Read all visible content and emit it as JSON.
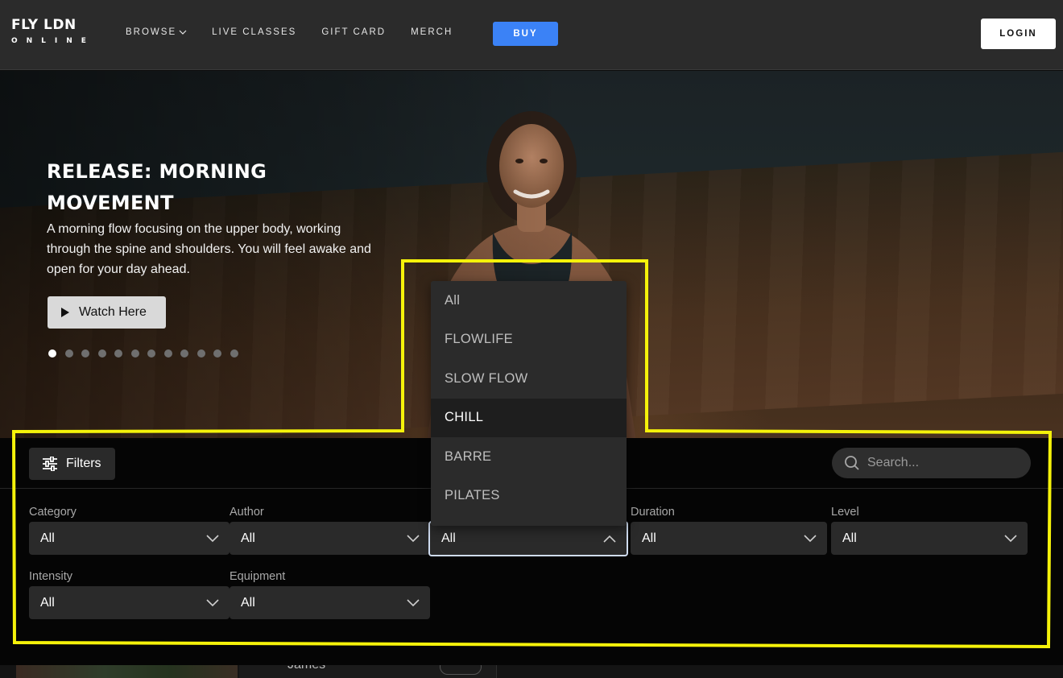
{
  "nav": {
    "logo_main": "FLY LDN",
    "logo_sub": "ONLINE",
    "links": [
      "BROWSE",
      "LIVE CLASSES",
      "GIFT CARD",
      "MERCH"
    ],
    "buy_label": "BUY",
    "login_label": "LOGIN"
  },
  "hero": {
    "title": "RELEASE: MORNING MOVEMENT",
    "description": "A morning flow focusing on the upper body, working through the spine and shoulders. You will feel awake and open for your day ahead.",
    "watch_label": "Watch Here",
    "slide_count": 12,
    "active_slide": 1
  },
  "filters": {
    "button_label": "Filters",
    "search_placeholder": "Search...",
    "fields": [
      {
        "label": "Category",
        "value": "All"
      },
      {
        "label": "Author",
        "value": "All"
      },
      {
        "label": "",
        "value": "All",
        "open": true
      },
      {
        "label": "Duration",
        "value": "All"
      },
      {
        "label": "Level",
        "value": "All"
      },
      {
        "label": "Intensity",
        "value": "All"
      },
      {
        "label": "Equipment",
        "value": "All"
      }
    ],
    "dropdown_options": [
      "All",
      "FLOWLIFE",
      "SLOW FLOW",
      "CHILL",
      "BARRE",
      "PILATES"
    ],
    "hovered_option": "CHILL"
  },
  "bottom": {
    "author_name": "James"
  },
  "colors": {
    "nav_bg": "#2b2b2b",
    "accent_blue": "#3b82f6",
    "panel_bg": "#050505",
    "select_bg": "#2a2a2a",
    "highlight_yellow": "#f5f20a"
  }
}
